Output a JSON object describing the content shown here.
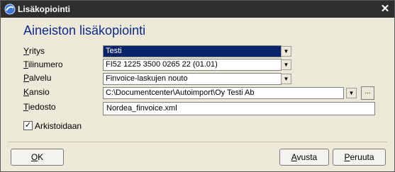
{
  "window": {
    "title": "Lisäkopiointi",
    "close_glyph": "✕"
  },
  "heading": "Aineiston lisäkopiointi",
  "fields": {
    "yritys": {
      "label_u": "Y",
      "label_rest": "ritys",
      "value": "Testi"
    },
    "tilinumero": {
      "label_u": "T",
      "label_rest": "ilinumero",
      "value": "FI52 1225 3500 0265 22  (01.01)"
    },
    "palvelu": {
      "label_u": "P",
      "label_rest": "alvelu",
      "value": "Finvoice-laskujen nouto"
    },
    "kansio": {
      "label_u": "K",
      "label_rest": "ansio",
      "value": "C:\\Documentcenter\\Autoimport\\Oy Testi Ab",
      "browse_label": "..."
    },
    "tiedosto": {
      "label_u": "T",
      "label_rest": "iedosto",
      "value": "Nordea_finvoice.xml"
    }
  },
  "checkbox": {
    "label": "Arkistoidaan",
    "checked_glyph": "✓",
    "checked": true
  },
  "buttons": {
    "ok": {
      "u": "O",
      "rest": "K"
    },
    "avusta": {
      "u": "A",
      "rest": "vusta"
    },
    "peruuta": {
      "u": "P",
      "rest": "eruuta"
    }
  },
  "icons": {
    "title": "app-logo-icon",
    "dropdown": "chevron-down-icon",
    "close": "close-icon"
  },
  "colors": {
    "titlebar": "#2f2f2f",
    "heading": "#0b2a8c",
    "selection": "#0a246a",
    "background": "#ece9d8"
  }
}
